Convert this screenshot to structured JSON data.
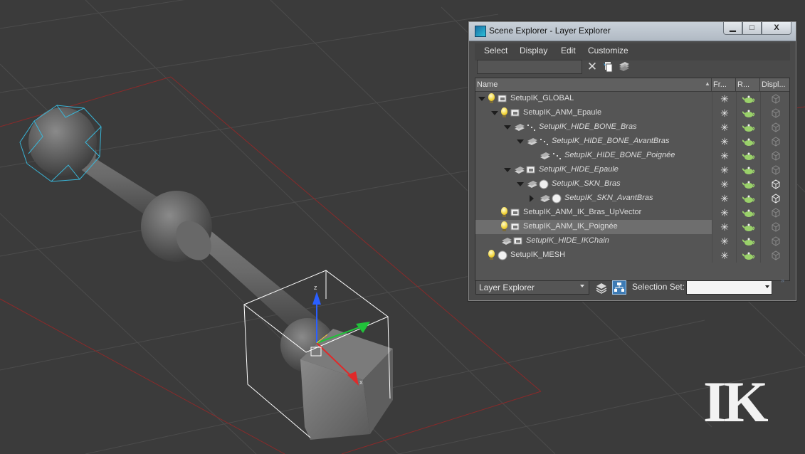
{
  "window": {
    "title": "Scene Explorer - Layer Explorer",
    "min_label": "▁",
    "max_label": "□",
    "close_label": "X"
  },
  "menu": [
    "Select",
    "Display",
    "Edit",
    "Customize"
  ],
  "toolbar": {
    "clear_label": "✕",
    "search_value": ""
  },
  "columns": {
    "name": "Name",
    "freeze": "Fr...",
    "render": "R...",
    "display": "Displ..."
  },
  "rows": [
    {
      "label": "SetupIK_GLOBAL",
      "italic": false,
      "expander": "open",
      "icon": "layer-active-bulb"
    },
    {
      "label": "SetupIK_ANM_Epaule",
      "italic": false,
      "expander": "open",
      "icon": "layer-active-bulb"
    },
    {
      "label": "SetupIK_HIDE_BONE_Bras",
      "italic": true,
      "expander": "open",
      "icon": "layer-hidden"
    },
    {
      "label": "SetupIK_HIDE_BONE_AvantBras",
      "italic": true,
      "expander": "open",
      "icon": "layer-hidden"
    },
    {
      "label": "SetupIK_HIDE_BONE_Poignée",
      "italic": true,
      "expander": "none",
      "icon": "layer-hidden"
    },
    {
      "label": "SetupIK_HIDE_Epaule",
      "italic": true,
      "expander": "open",
      "icon": "layer-hidden"
    },
    {
      "label": "SetupIK_SKN_Bras",
      "italic": true,
      "expander": "open",
      "icon": "layer-hidden-sphere"
    },
    {
      "label": "SetupIK_SKN_AvantBras",
      "italic": true,
      "expander": "closed",
      "icon": "layer-hidden-sphere"
    },
    {
      "label": "SetupIK_ANM_IK_Bras_UpVector",
      "italic": false,
      "expander": "none",
      "icon": "layer-active-bulb"
    },
    {
      "label": "SetupIK_ANM_IK_Poignée",
      "italic": false,
      "expander": "none",
      "icon": "layer-active-bulb",
      "selected": true
    },
    {
      "label": "SetupIK_HIDE_IKChain",
      "italic": true,
      "expander": "none",
      "icon": "layer-hidden"
    },
    {
      "label": "SetupIK_MESH",
      "italic": false,
      "expander": "none",
      "icon": "layer-active-bulb"
    }
  ],
  "bottom": {
    "explorer_mode": "Layer Explorer",
    "selection_set_label": "Selection Set:",
    "selection_set_value": "",
    "more_label": "»"
  },
  "viewport": {
    "watermark": "IK",
    "gizmo_labels": {
      "z": "z",
      "x": "x"
    }
  },
  "colors": {
    "viewport_bg": "#3b3b3b",
    "grid": "#4c4c4c",
    "home_grid": "#8a2a2a",
    "selection_bracket": "#ffffff",
    "bone_selection": "#39b6d8"
  }
}
